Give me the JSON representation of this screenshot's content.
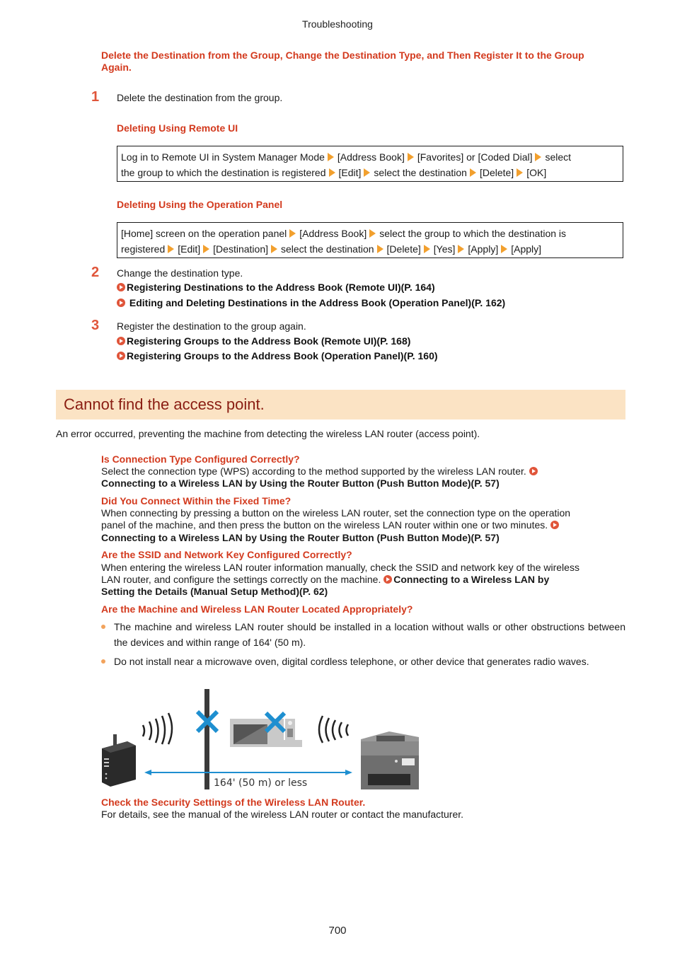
{
  "header": {
    "running_title": "Troubleshooting"
  },
  "section1": {
    "heading": "Delete the Destination from the Group, Change the Destination Type, and Then Register It to the Group Again.",
    "steps": [
      {
        "number": "1",
        "text": "Delete the destination from the group.",
        "subsections": [
          {
            "title": "Deleting Using Remote UI",
            "path_line1": [
              "Log in to Remote UI in System Manager Mode",
              "[Address Book]",
              "[Favorites] or [Coded Dial]",
              "select"
            ],
            "path_line2": [
              "the group to which the destination is registered",
              "[Edit]",
              "select the destination",
              "[Delete]",
              "[OK]"
            ]
          },
          {
            "title": "Deleting Using the Operation Panel",
            "path_line1": [
              "[Home] screen on the operation panel",
              "[Address Book]",
              "select the group to which the destination is"
            ],
            "path_line2": [
              "registered",
              "[Edit]",
              "[Destination]",
              "select the destination",
              "[Delete]",
              "[Yes]",
              "[Apply]",
              "[Apply]"
            ]
          }
        ]
      },
      {
        "number": "2",
        "text": "Change the destination type.",
        "links": [
          "Registering Destinations to the Address Book (Remote UI)(P. 164)",
          " Editing and Deleting Destinations in the Address Book (Operation Panel)(P. 162)"
        ]
      },
      {
        "number": "3",
        "text": "Register the destination to the group again.",
        "links": [
          "Registering Groups to the Address Book (Remote UI)(P. 168)",
          "Registering Groups to the Address Book (Operation Panel)(P. 160)"
        ]
      }
    ]
  },
  "section2": {
    "banner_title": "Cannot find the access point.",
    "intro": "An error occurred, preventing the machine from detecting the wireless LAN router (access point).",
    "checks": [
      {
        "question": "Is Connection Type Configured Correctly?",
        "body": "Select the connection type (WPS) according to the method supported by the wireless LAN router.",
        "link": "Connecting to a Wireless LAN by Using the Router Button (Push Button Mode)(P. 57)"
      },
      {
        "question": "Did You Connect Within the Fixed Time?",
        "body_line1": "When connecting by pressing a button on the wireless LAN router, set the connection type on the operation",
        "body_line2": "panel of the machine, and then press the button on the wireless LAN router within one or two minutes.",
        "link": "Connecting to a Wireless LAN by Using the Router Button (Push Button Mode)(P. 57)"
      },
      {
        "question": "Are the SSID and Network Key Configured Correctly?",
        "body_line1": "When entering the wireless LAN router information manually, check the SSID and network key of the wireless",
        "body_line2": "LAN router, and configure the settings correctly on the machine.",
        "link_part1": "Connecting to a Wireless LAN by",
        "link_part2": "Setting the Details (Manual Setup Method)(P. 62)"
      },
      {
        "question": "Are the Machine and Wireless LAN Router Located Appropriately?",
        "bullets": [
          "The machine and wireless LAN router should be installed in a location without walls or other obstructions between the devices and within range of 164' (50 m).",
          "Do not install near a microwave oven, digital cordless telephone, or other device that generates radio waves."
        ]
      },
      {
        "question": "Check the Security Settings of the Wireless LAN Router.",
        "body": "For details, see the manual of the wireless LAN router or contact the manufacturer."
      }
    ],
    "illustration": {
      "distance_label": "164' (50 m) or less",
      "accent_color": "#1e8fd0"
    }
  },
  "footer": {
    "page_number": "700"
  }
}
